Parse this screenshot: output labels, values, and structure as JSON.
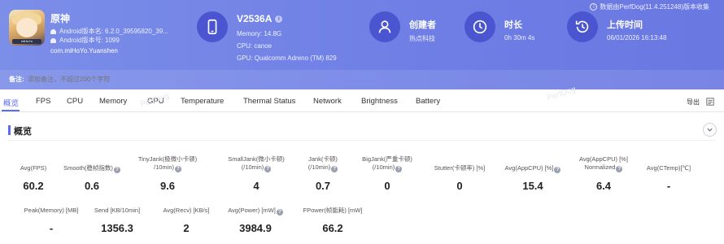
{
  "data_source": "数据由PerfDog(11.4.251248)版本收集",
  "app": {
    "name": "原神",
    "version": "Android版本名: 6.2.0_39595820_39...",
    "version_code": "Android版本号: 1099",
    "package": "com.miHoYo.Yuanshen",
    "icon_tag": "miHoYo"
  },
  "device": {
    "name": "V2536A",
    "memory": "Memory: 14.8G",
    "cpu": "CPU: canoe",
    "gpu": "GPU: Qualcomm Adreno (TM) 829"
  },
  "creator": {
    "label": "创建者",
    "value": "热点科技"
  },
  "duration": {
    "label": "时长",
    "value": "0h 30m 4s"
  },
  "upload": {
    "label": "上传时间",
    "value": "06/01/2026 16:13:48"
  },
  "note": {
    "label": "备注:",
    "placeholder": "添加备注，不超过200个字符"
  },
  "tabs": [
    "概览",
    "FPS",
    "CPU",
    "Memory",
    "GPU",
    "Temperature",
    "Thermal Status",
    "Network",
    "Brightness",
    "Battery"
  ],
  "active_tab": 0,
  "export_label": "导出",
  "watermark": "PerfDog",
  "section_title": "概览",
  "metrics_row1": [
    {
      "label1": "Avg(FPS)",
      "label2": "",
      "help": false,
      "value": "60.2"
    },
    {
      "label1": "Smooth(稳帧指数)",
      "label2": "",
      "help": true,
      "value": "0.6"
    },
    {
      "label1": "TinyJank(极微小卡顿)",
      "label2": "/10min)",
      "help": true,
      "value": "9.6"
    },
    {
      "label1": "SmallJank(微小卡顿)",
      "label2": "(/10min)",
      "help": true,
      "value": "4"
    },
    {
      "label1": "Jank(卡顿)",
      "label2": "(/10min)",
      "help": true,
      "value": "0.7"
    },
    {
      "label1": "BigJank(严重卡顿)",
      "label2": "(/10min)",
      "help": true,
      "value": "0"
    },
    {
      "label1": "Stutter(卡顿率) [%]",
      "label2": "",
      "help": false,
      "value": "0"
    },
    {
      "label1": "Avg(AppCPU) [%]",
      "label2": "",
      "help": true,
      "value": "15.4"
    },
    {
      "label1": "Avg(AppCPU) [%]",
      "label2": "Normalized",
      "help": true,
      "value": "6.4"
    },
    {
      "label1": "Avg(CTemp)[℃]",
      "label2": "",
      "help": false,
      "value": "-"
    }
  ],
  "metrics_row2": [
    {
      "label1": "Peak(Memory) [MB]",
      "help": false,
      "value": "-"
    },
    {
      "label1": "Send [KB/10min]",
      "help": false,
      "value": "1356.3"
    },
    {
      "label1": "Avg(Recv) [KB/s]",
      "help": false,
      "value": "2"
    },
    {
      "label1": "Avg(Power) [mW]",
      "help": true,
      "value": "3984.9"
    },
    {
      "label1": "FPower(帧能耗) [mW]",
      "help": false,
      "value": "66.2"
    }
  ],
  "colors": {
    "banner": "#7080e4",
    "icon_circle": "#4a55cf",
    "accent": "#5b6cf0"
  }
}
